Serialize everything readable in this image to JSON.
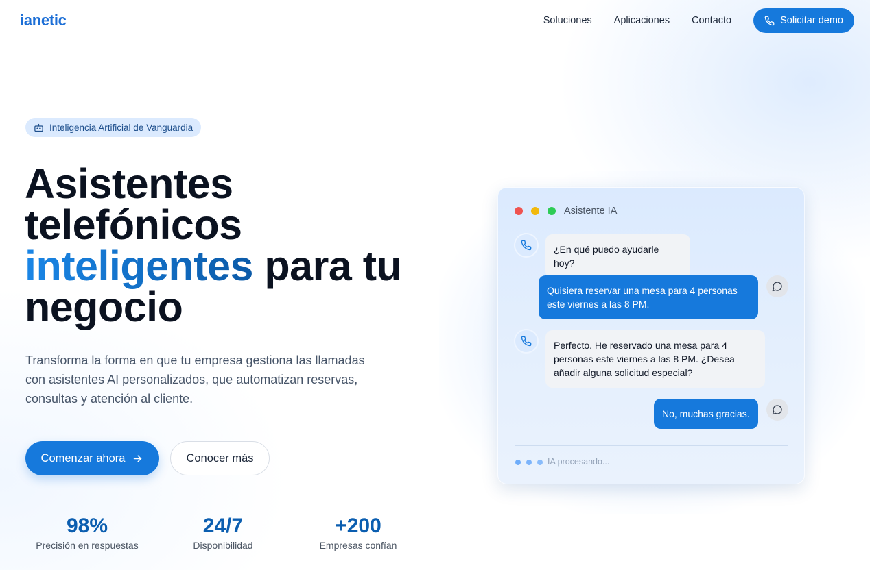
{
  "nav": {
    "logo": "ianetic",
    "links": [
      "Soluciones",
      "Aplicaciones",
      "Contacto"
    ],
    "cta": "Solicitar demo"
  },
  "hero": {
    "badge": "Inteligencia Artificial de Vanguardia",
    "title_line1": "Asistentes",
    "title_line2": "telefónicos",
    "title_accent": "inteligentes",
    "title_line3_rest": " para tu",
    "title_line4": "negocio",
    "description": "Transforma la forma en que tu empresa gestiona las llamadas con asistentes AI personalizados, que automatizan reservas, consultas y atención al cliente.",
    "primary_button": "Comenzar ahora",
    "secondary_button": "Conocer más",
    "stats": [
      {
        "value": "98%",
        "label": "Precisión en respuestas"
      },
      {
        "value": "24/7",
        "label": "Disponibilidad"
      },
      {
        "value": "+200",
        "label": "Empresas confían"
      }
    ]
  },
  "chat": {
    "title": "Asistente IA",
    "messages": [
      {
        "from": "ai",
        "text": "¿En qué puedo ayudarle hoy?"
      },
      {
        "from": "user",
        "text": "Quisiera reservar una mesa para 4 personas este viernes a las 8 PM."
      },
      {
        "from": "ai",
        "text": "Perfecto. He reservado una mesa para 4 personas este viernes a las 8 PM. ¿Desea añadir alguna solicitud especial?"
      },
      {
        "from": "user",
        "text": "No, muchas gracias."
      }
    ],
    "status": "IA procesando..."
  },
  "colors": {
    "accent": "#1679dc",
    "window_dot_red": "#ef4444",
    "window_dot_yellow": "#eab308",
    "window_dot_green": "#22c55e"
  },
  "icons": [
    "phone-icon",
    "bot-icon",
    "arrow-right-icon",
    "chat-bubble-icon"
  ]
}
